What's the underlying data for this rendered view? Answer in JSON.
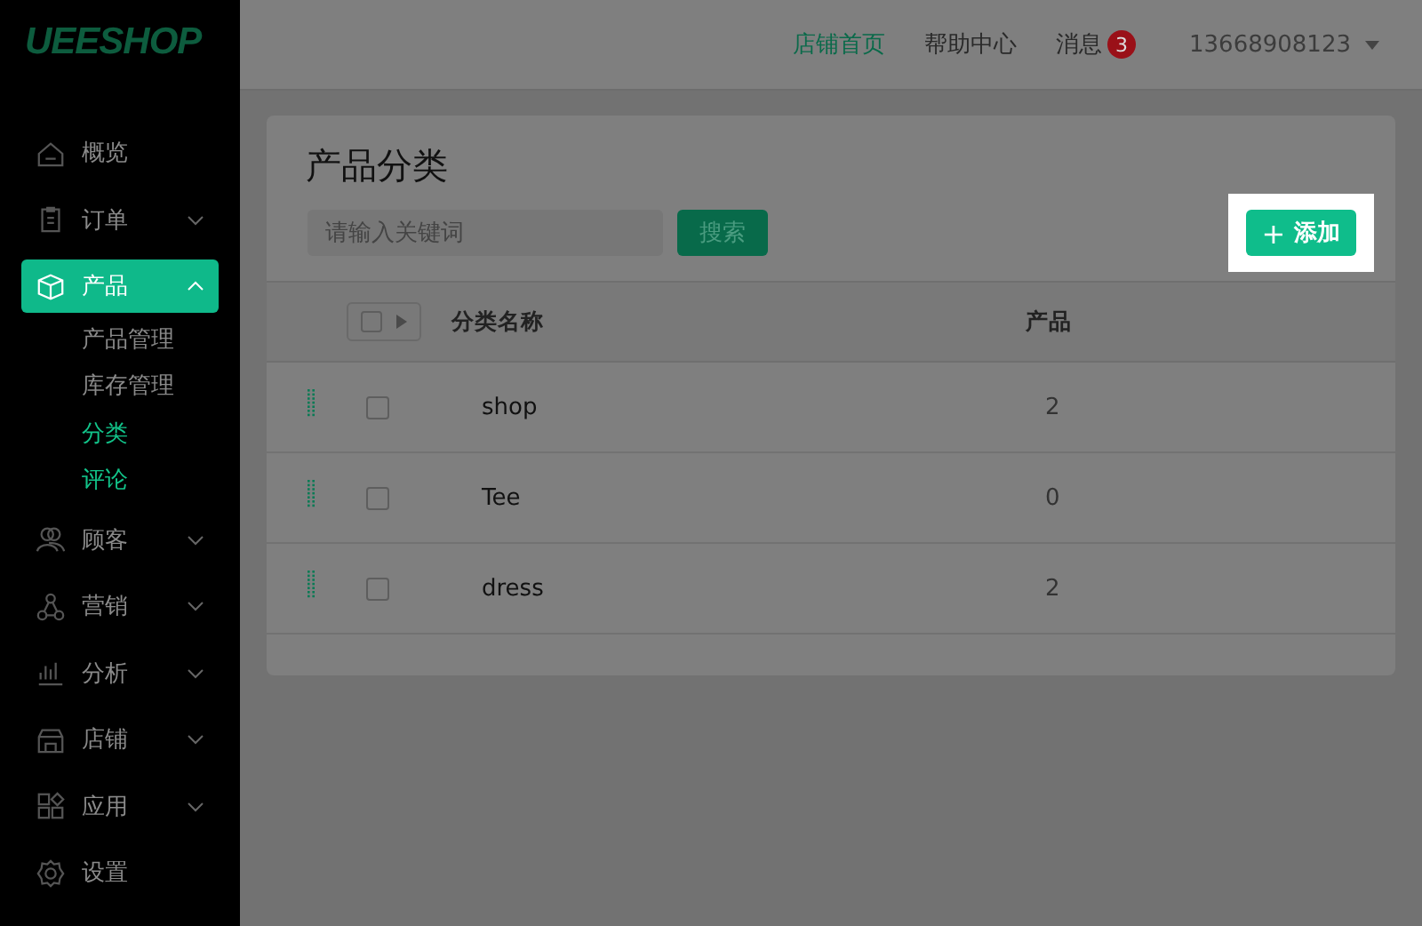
{
  "logo": "UEESHOP",
  "sidebar": {
    "items": [
      {
        "label": "概览",
        "selected": false
      },
      {
        "label": "订单",
        "expanded": false,
        "selected": false
      },
      {
        "label": "产品",
        "expanded": true,
        "selected": true,
        "children": [
          {
            "label": "产品管理",
            "selected": false
          },
          {
            "label": "库存管理",
            "selected": false
          },
          {
            "label": "分类",
            "selected": true
          },
          {
            "label": "评论",
            "selected": true
          }
        ]
      },
      {
        "label": "顾客",
        "expanded": false,
        "selected": false
      },
      {
        "label": "营销",
        "expanded": false,
        "selected": false
      },
      {
        "label": "分析",
        "expanded": false,
        "selected": false
      },
      {
        "label": "店铺",
        "expanded": false,
        "selected": false
      },
      {
        "label": "应用",
        "expanded": false,
        "selected": false
      },
      {
        "label": "设置",
        "selected": false
      }
    ]
  },
  "topbar": {
    "links": [
      {
        "label": "店铺首页",
        "selected": true
      },
      {
        "label": "帮助中心",
        "selected": false
      },
      {
        "label": "消息",
        "selected": false,
        "badge": "3"
      }
    ],
    "account": "13668908123"
  },
  "page": {
    "title": "产品分类",
    "search": {
      "placeholder": "请输入关键词",
      "button": "搜索"
    },
    "add_button": {
      "icon": "+",
      "label": "添加",
      "highlighted": true
    }
  },
  "table": {
    "select_all_checked": false,
    "columns": [
      "分类名称",
      "产品"
    ],
    "rows": [
      {
        "name": "shop",
        "products": "2",
        "checked": false
      },
      {
        "name": "Tee",
        "products": "0",
        "checked": false
      },
      {
        "name": "dress",
        "products": "2",
        "checked": false
      }
    ]
  }
}
